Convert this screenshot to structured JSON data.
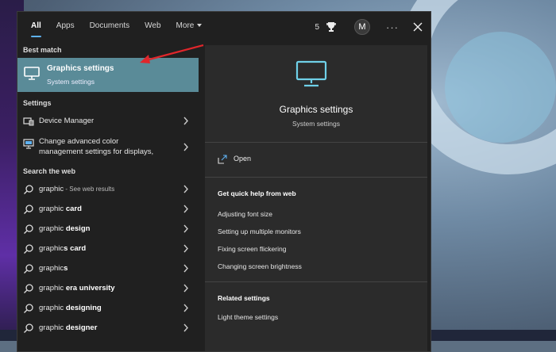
{
  "tabs": [
    {
      "label": "All"
    },
    {
      "label": "Apps"
    },
    {
      "label": "Documents"
    },
    {
      "label": "Web"
    },
    {
      "label": "More"
    }
  ],
  "header": {
    "points": "5",
    "avatar_initial": "M",
    "more_options": "···"
  },
  "left": {
    "best_match_heading": "Best match",
    "best_match": {
      "title": "Graphics settings",
      "subtitle": "System settings",
      "icon": "monitor-icon"
    },
    "settings_heading": "Settings",
    "settings_items": [
      {
        "label": "Device Manager",
        "icon": "device-manager-icon"
      },
      {
        "line1": "Change advanced color",
        "line2": "management settings for displays,",
        "icon": "display-settings-icon"
      }
    ],
    "web_heading": "Search the web",
    "web_items": [
      {
        "plain": "graphic",
        "bold": "",
        "muted": " - See web results"
      },
      {
        "plain": "graphic ",
        "bold": "card",
        "muted": ""
      },
      {
        "plain": "graphic ",
        "bold": "design",
        "muted": ""
      },
      {
        "plain": "graphic",
        "bold": "s card",
        "muted": ""
      },
      {
        "plain": "graphic",
        "bold": "s",
        "muted": ""
      },
      {
        "plain": "graphic ",
        "bold": "era university",
        "muted": ""
      },
      {
        "plain": "graphic ",
        "bold": "designing",
        "muted": ""
      },
      {
        "plain": "graphic ",
        "bold": "designer",
        "muted": ""
      }
    ]
  },
  "preview": {
    "title": "Graphics settings",
    "subtitle": "System settings",
    "open_label": "Open",
    "quick_help_heading": "Get quick help from web",
    "quick_help_links": [
      "Adjusting font size",
      "Setting up multiple monitors",
      "Fixing screen flickering",
      "Changing screen brightness"
    ],
    "related_heading": "Related settings",
    "related_links": [
      "Light theme settings"
    ]
  },
  "colors": {
    "accent": "#5fb2f2",
    "selection": "#5a8b98",
    "panel": "#202020",
    "preview_bg": "#2b2b2b",
    "annotation_arrow": "#e0262b"
  }
}
